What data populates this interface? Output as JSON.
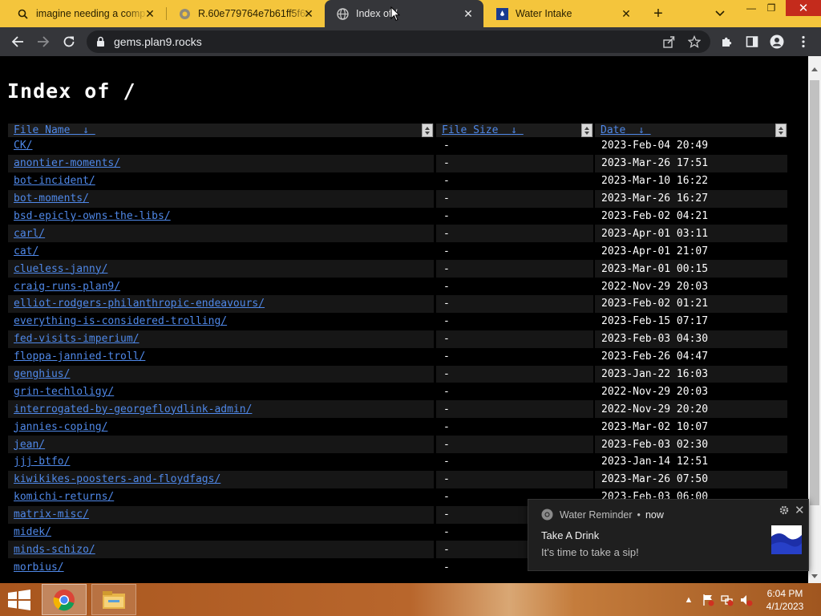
{
  "browser": {
    "tabs": [
      {
        "title": "imagine needing a comp",
        "favicon": "search-icon",
        "active": false
      },
      {
        "title": "R.60e779764e7b61ff5f60",
        "favicon": "globe-icon",
        "active": false
      },
      {
        "title": "Index of /",
        "favicon": "globe-icon",
        "active": true
      },
      {
        "title": "Water Intake",
        "favicon": "water-app-icon",
        "active": false
      }
    ],
    "url": "gems.plan9.rocks",
    "accent": "#f4c53c",
    "toolbar_color": "#35363a"
  },
  "page": {
    "title": "Index of /",
    "columns": [
      "File Name",
      "File Size",
      "Date"
    ],
    "sort_arrow": "↓",
    "rows": [
      {
        "name": "CK/",
        "size": "-",
        "date": "2023-Feb-04 20:49"
      },
      {
        "name": "anontier-moments/",
        "size": "-",
        "date": "2023-Mar-26 17:51"
      },
      {
        "name": "bot-incident/",
        "size": "-",
        "date": "2023-Mar-10 16:22"
      },
      {
        "name": "bot-moments/",
        "size": "-",
        "date": "2023-Mar-26 16:27"
      },
      {
        "name": "bsd-epicly-owns-the-libs/",
        "size": "-",
        "date": "2023-Feb-02 04:21"
      },
      {
        "name": "carl/",
        "size": "-",
        "date": "2023-Apr-01 03:11"
      },
      {
        "name": "cat/",
        "size": "-",
        "date": "2023-Apr-01 21:07"
      },
      {
        "name": "clueless-janny/",
        "size": "-",
        "date": "2023-Mar-01 00:15"
      },
      {
        "name": "craig-runs-plan9/",
        "size": "-",
        "date": "2022-Nov-29 20:03"
      },
      {
        "name": "elliot-rodgers-philanthropic-endeavours/",
        "size": "-",
        "date": "2023-Feb-02 01:21"
      },
      {
        "name": "everything-is-considered-trolling/",
        "size": "-",
        "date": "2023-Feb-15 07:17"
      },
      {
        "name": "fed-visits-imperium/",
        "size": "-",
        "date": "2023-Feb-03 04:30"
      },
      {
        "name": "floppa-jannied-troll/",
        "size": "-",
        "date": "2023-Feb-26 04:47"
      },
      {
        "name": "genghius/",
        "size": "-",
        "date": "2023-Jan-22 16:03"
      },
      {
        "name": "grin-techloligy/",
        "size": "-",
        "date": "2022-Nov-29 20:03"
      },
      {
        "name": "interrogated-by-georgefloydlink-admin/",
        "size": "-",
        "date": "2022-Nov-29 20:20"
      },
      {
        "name": "jannies-coping/",
        "size": "-",
        "date": "2023-Mar-02 10:07"
      },
      {
        "name": "jean/",
        "size": "-",
        "date": "2023-Feb-03 02:30"
      },
      {
        "name": "jjj-btfo/",
        "size": "-",
        "date": "2023-Jan-14 12:51"
      },
      {
        "name": "kiwikikes-poosters-and-floydfags/",
        "size": "-",
        "date": "2023-Mar-26 07:50"
      },
      {
        "name": "komichi-returns/",
        "size": "-",
        "date": "2023-Feb-03 06:00"
      },
      {
        "name": "matrix-misc/",
        "size": "-",
        "date": ""
      },
      {
        "name": "midek/",
        "size": "-",
        "date": ""
      },
      {
        "name": "minds-schizo/",
        "size": "-",
        "date": ""
      },
      {
        "name": "morbius/",
        "size": "-",
        "date": ""
      }
    ]
  },
  "notification": {
    "app": "Water Reminder",
    "when": "now",
    "title": "Take A Drink",
    "body": "It's time to take a sip!"
  },
  "taskbar": {
    "time": "6:04 PM",
    "date": "4/1/2023"
  }
}
